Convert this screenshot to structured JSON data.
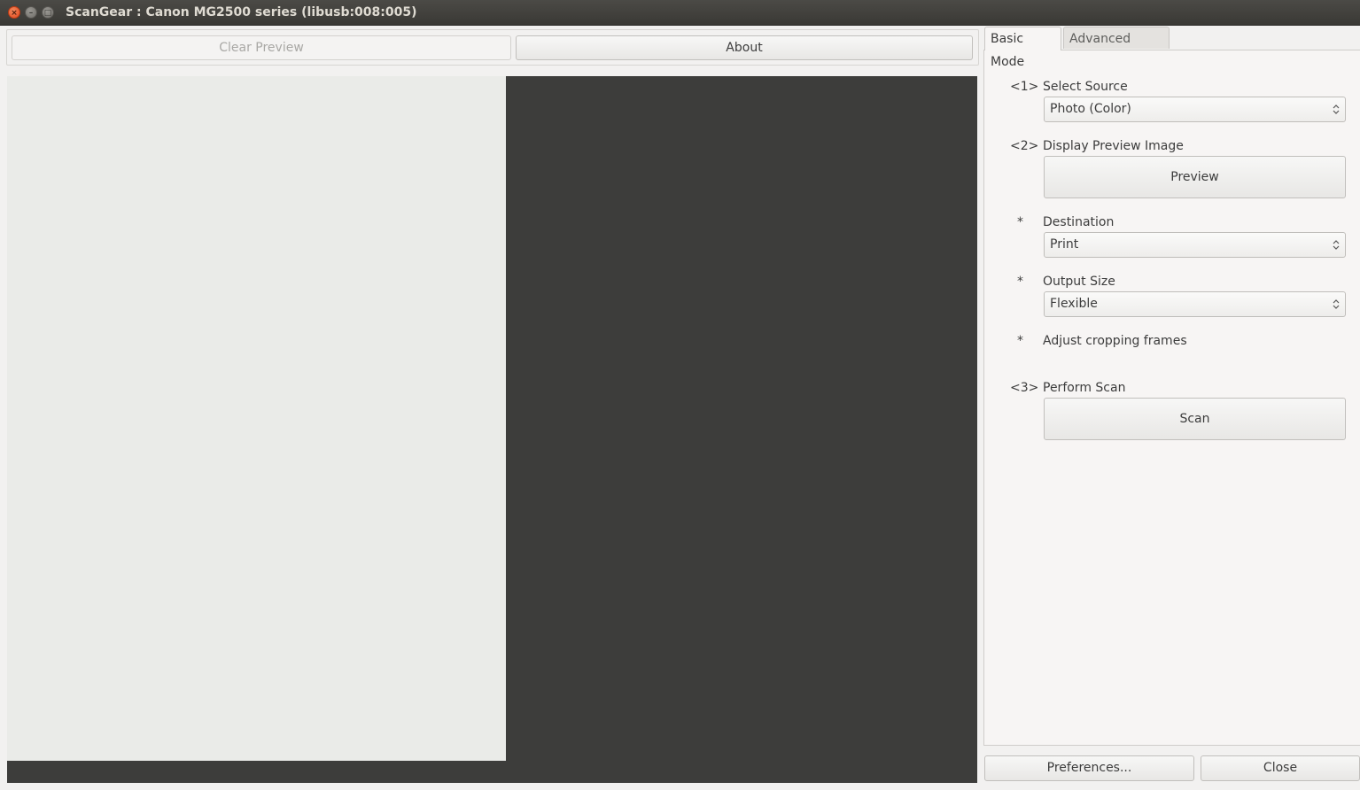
{
  "window": {
    "title": "ScanGear : Canon MG2500 series (libusb:008:005)"
  },
  "toolbar": {
    "clear_preview_label": "Clear Preview",
    "about_label": "About"
  },
  "tabs": {
    "basic_label": "Basic Mode",
    "advanced_label": "Advanced Mode"
  },
  "steps": {
    "select_source": {
      "marker": "<1>",
      "label": "Select Source",
      "value": "Photo (Color)"
    },
    "display_preview": {
      "marker": "<2>",
      "label": "Display Preview Image",
      "button": "Preview"
    },
    "destination": {
      "marker": "*",
      "label": "Destination",
      "value": "Print"
    },
    "output_size": {
      "marker": "*",
      "label": "Output Size",
      "value": "Flexible"
    },
    "adjust_cropping": {
      "marker": "*",
      "label": "Adjust cropping frames"
    },
    "perform_scan": {
      "marker": "<3>",
      "label": "Perform Scan",
      "button": "Scan"
    }
  },
  "footer": {
    "preferences_label": "Preferences...",
    "close_label": "Close"
  },
  "colors": {
    "preview_background": "#3d3d3b",
    "preview_page": "#eaebe8",
    "close_button": "#e0471d"
  }
}
